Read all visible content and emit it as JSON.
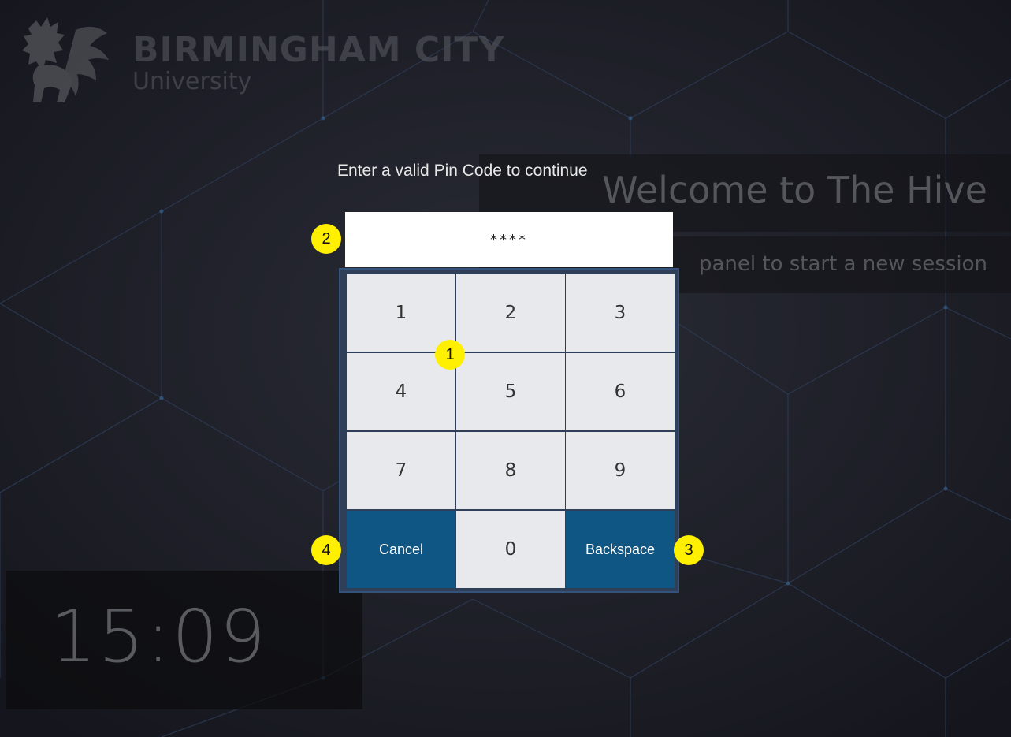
{
  "branding": {
    "name_line1": "BIRMINGHAM CITY",
    "name_line2": "University"
  },
  "background": {
    "welcome_title": "Welcome to The Hive",
    "welcome_subtitle": "panel to start a new session",
    "clock": "15:09"
  },
  "pin_dialog": {
    "prompt": "Enter a valid Pin Code to continue",
    "masked_pin": "****",
    "keys": {
      "k1": "1",
      "k2": "2",
      "k3": "3",
      "k4": "4",
      "k5": "5",
      "k6": "6",
      "k7": "7",
      "k8": "8",
      "k9": "9",
      "k0": "0",
      "cancel": "Cancel",
      "backspace": "Backspace"
    }
  },
  "annotations": {
    "a1": "1",
    "a2": "2",
    "a3": "3",
    "a4": "4"
  },
  "colors": {
    "action_key": "#0f5684",
    "number_key": "#e8e9ec",
    "annotation_badge": "#ffef00",
    "background": "#1a1c24"
  }
}
